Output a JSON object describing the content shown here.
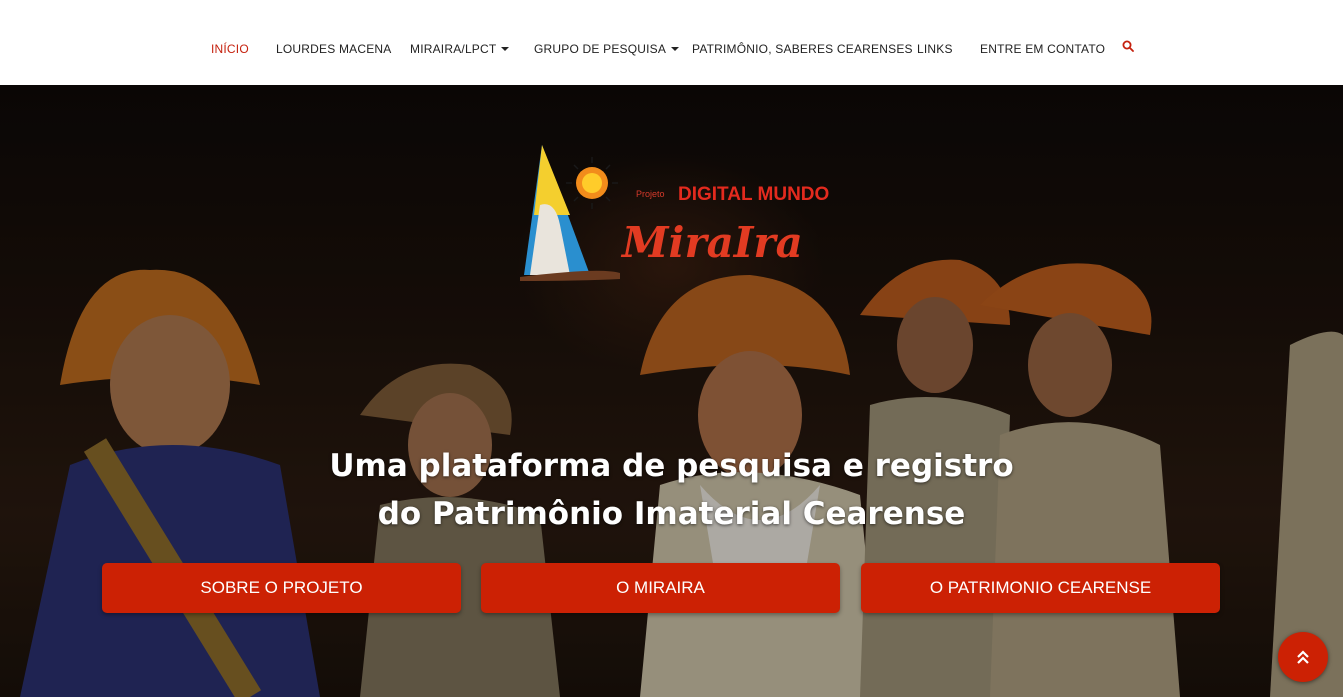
{
  "nav": {
    "items": [
      {
        "label": "INÍCIO",
        "active": true,
        "dropdown": false
      },
      {
        "label": "LOURDES MACENA",
        "active": false,
        "dropdown": false
      },
      {
        "label": "MIRAIRA/LPCT",
        "active": false,
        "dropdown": true
      },
      {
        "label": "GRUPO DE PESQUISA",
        "active": false,
        "dropdown": true
      },
      {
        "label": "PATRIMÔNIO, SABERES CEARENSES",
        "active": false,
        "dropdown": false
      },
      {
        "label": "LINKS",
        "active": false,
        "dropdown": false
      },
      {
        "label": "ENTRE EM CONTATO",
        "active": false,
        "dropdown": false
      }
    ],
    "search_icon": "search-icon"
  },
  "logo": {
    "prefix": "Projeto",
    "line1": "DIGITAL MUNDO",
    "line2": "MiraIra"
  },
  "hero": {
    "headline_line1": "Uma plataforma de pesquisa e registro",
    "headline_line2": "do Patrimônio Imaterial Cearense",
    "buttons": [
      "SOBRE O PROJETO",
      "O MIRAIRA",
      "O PATRIMONIO CEARENSE"
    ]
  },
  "back_to_top_icon": "double-chevron-up-icon",
  "colors": {
    "accent": "#cc2104",
    "active_nav": "#c5210e",
    "nav_text": "#222222",
    "nav_bg": "#ffffff"
  }
}
